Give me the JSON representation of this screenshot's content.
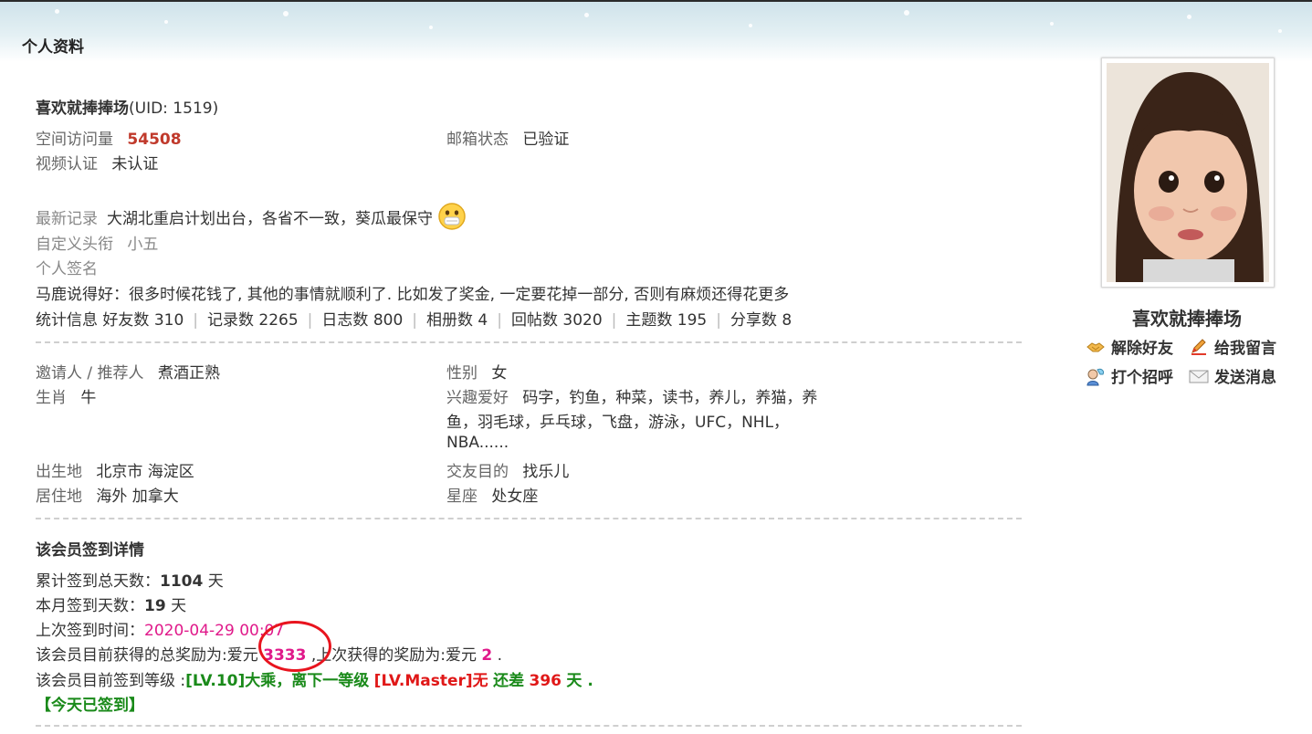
{
  "page": {
    "title": "个人资料"
  },
  "profile": {
    "username": "喜欢就捧捧场",
    "uid_text": "(UID: 1519)",
    "visits_label": "空间访问量",
    "visits_value": "54508",
    "email_label": "邮箱状态",
    "email_value": "已验证",
    "video_label": "视频认证",
    "video_value": "未认证",
    "latest_label": "最新记录",
    "latest_value": "大湖北重启计划出台，各省不一致，葵瓜最保守",
    "latest_emoji": "emoji-face-icon",
    "title_label": "自定义头衔",
    "title_value": "小五",
    "sign_label": "个人签名",
    "sign_value": "马鹿说得好：很多时候花钱了, 其他的事情就顺利了. 比如发了奖金, 一定要花掉一部分, 否则有麻烦还得花更多",
    "stats_label": "统计信息",
    "stats": [
      {
        "label": "好友数",
        "value": "310"
      },
      {
        "label": "记录数",
        "value": "2265"
      },
      {
        "label": "日志数",
        "value": "800"
      },
      {
        "label": "相册数",
        "value": "4"
      },
      {
        "label": "回帖数",
        "value": "3020"
      },
      {
        "label": "主题数",
        "value": "195"
      },
      {
        "label": "分享数",
        "value": "8"
      }
    ]
  },
  "details": {
    "inviter_label": "邀请人 / 推荐人",
    "inviter_value": "煮酒正熟",
    "zodiac_label": "生肖",
    "zodiac_value": "牛",
    "gender_label": "性别",
    "gender_value": "女",
    "hobby_label": "兴趣爱好",
    "hobby_line1": "码字，钓鱼，种菜，读书，养儿，养猫，养",
    "hobby_line2": "鱼，羽毛球，乒乓球，飞盘，游泳，UFC，NHL，",
    "hobby_line3": "NBA......",
    "birthplace_label": "出生地",
    "birthplace_value": "北京市 海淀区",
    "purpose_label": "交友目的",
    "purpose_value": "找乐儿",
    "residence_label": "居住地",
    "residence_value": "海外 加拿大",
    "constellation_label": "星座",
    "constellation_value": "处女座"
  },
  "checkin": {
    "heading": "该会员签到详情",
    "total_label": "累计签到总天数：",
    "total_value": "1104",
    "day_unit": "天",
    "month_label": "本月签到天数：",
    "month_value": "19",
    "last_time_label": "上次签到时间：",
    "last_time_value": "2020-04-29 00:07",
    "reward_prefix": "该会员目前获得的总奖励为:爱元",
    "reward_total": "3333",
    "reward_mid": ",上次获得的奖励为:爱元",
    "reward_last": "2",
    "reward_end": ".",
    "level_prefix": "该会员目前签到等级 :",
    "level_current": "[LV.10]大乘",
    "level_mid": "，离下一等级",
    "level_next": "[LV.Master]无",
    "level_remain_label": "还差",
    "level_remain_value": "396",
    "level_remain_unit": "天 .",
    "today_status": "【今天已签到】"
  },
  "sidebar": {
    "display_name": "喜欢就捧捧场",
    "actions": [
      {
        "label": "解除好友",
        "icon": "handshake-icon"
      },
      {
        "label": "给我留言",
        "icon": "pencil-icon"
      },
      {
        "label": "打个招呼",
        "icon": "greet-icon"
      },
      {
        "label": "发送消息",
        "icon": "envelope-icon"
      }
    ]
  },
  "colors": {
    "accent_orange": "#c0392b",
    "magenta": "#e0198a",
    "green": "#1a8a1a",
    "red": "#e01818",
    "annotation_circle": "#e8141e"
  }
}
